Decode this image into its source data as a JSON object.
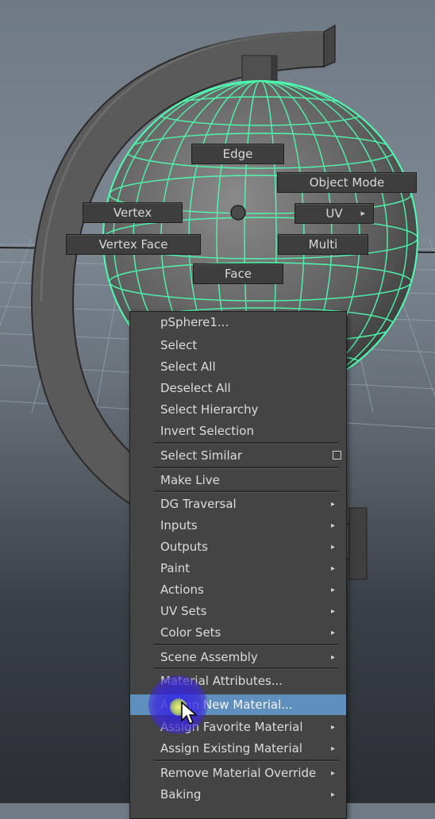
{
  "marking_menu": {
    "edge": "Edge",
    "object_mode": "Object Mode",
    "vertex": "Vertex",
    "uv": "UV",
    "vertex_face": "Vertex Face",
    "multi": "Multi",
    "face": "Face"
  },
  "context_menu": {
    "title": "pSphere1...",
    "items": [
      "Select",
      "Select All",
      "Deselect All",
      "Select Hierarchy",
      "Invert Selection",
      "Select Similar",
      "Make Live",
      "DG Traversal",
      "Inputs",
      "Outputs",
      "Paint",
      "Actions",
      "UV Sets",
      "Color Sets",
      "Scene Assembly",
      "Material Attributes...",
      "Assign New Material...",
      "Assign Favorite Material",
      "Assign Existing Material",
      "Remove Material Override",
      "Baking"
    ],
    "highlighted_item": "Assign New Material..."
  },
  "icons": {
    "submenu": "submenu-arrow-icon",
    "option_box": "option-box-icon",
    "cursor": "mouse-cursor-icon"
  },
  "colors": {
    "wireframe": "#4dffb0",
    "menu_bg": "#444444",
    "highlight": "#5f8fbd",
    "click_indicator": "#3a2be0"
  }
}
